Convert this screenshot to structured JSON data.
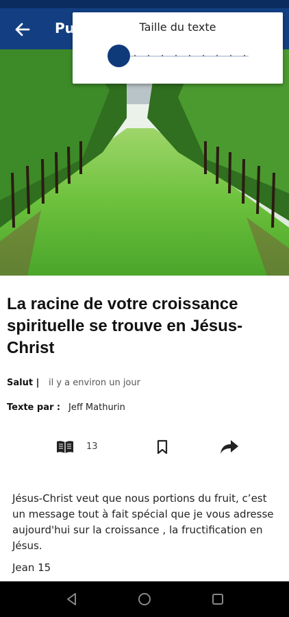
{
  "app_bar": {
    "title_visible_fragment": "Pu"
  },
  "popup": {
    "title": "Taille du texte",
    "slider_value": 0
  },
  "article": {
    "title": "La racine de votre croissance spirituelle se trouve en Jésus-Christ",
    "category_label": "Salut |",
    "time_text": "il y a environ un jour",
    "author_label": "Texte par :",
    "author_name": "Jeff Mathurin",
    "read_count": "13",
    "body": "Jésus-Christ veut que nous portions du fruit, c’est un message tout à fait spécial que je vous adresse aujourd'hui sur la croissance , la fructification en Jésus.",
    "reference": "Jean 15"
  },
  "colors": {
    "app_bar": "#133f82",
    "status_bar": "#0a2c5e",
    "accent": "#0f3a7a"
  },
  "icons": [
    "back-arrow-icon",
    "book-icon",
    "bookmark-icon",
    "share-icon",
    "nav-back-icon",
    "nav-home-icon",
    "nav-recents-icon"
  ]
}
